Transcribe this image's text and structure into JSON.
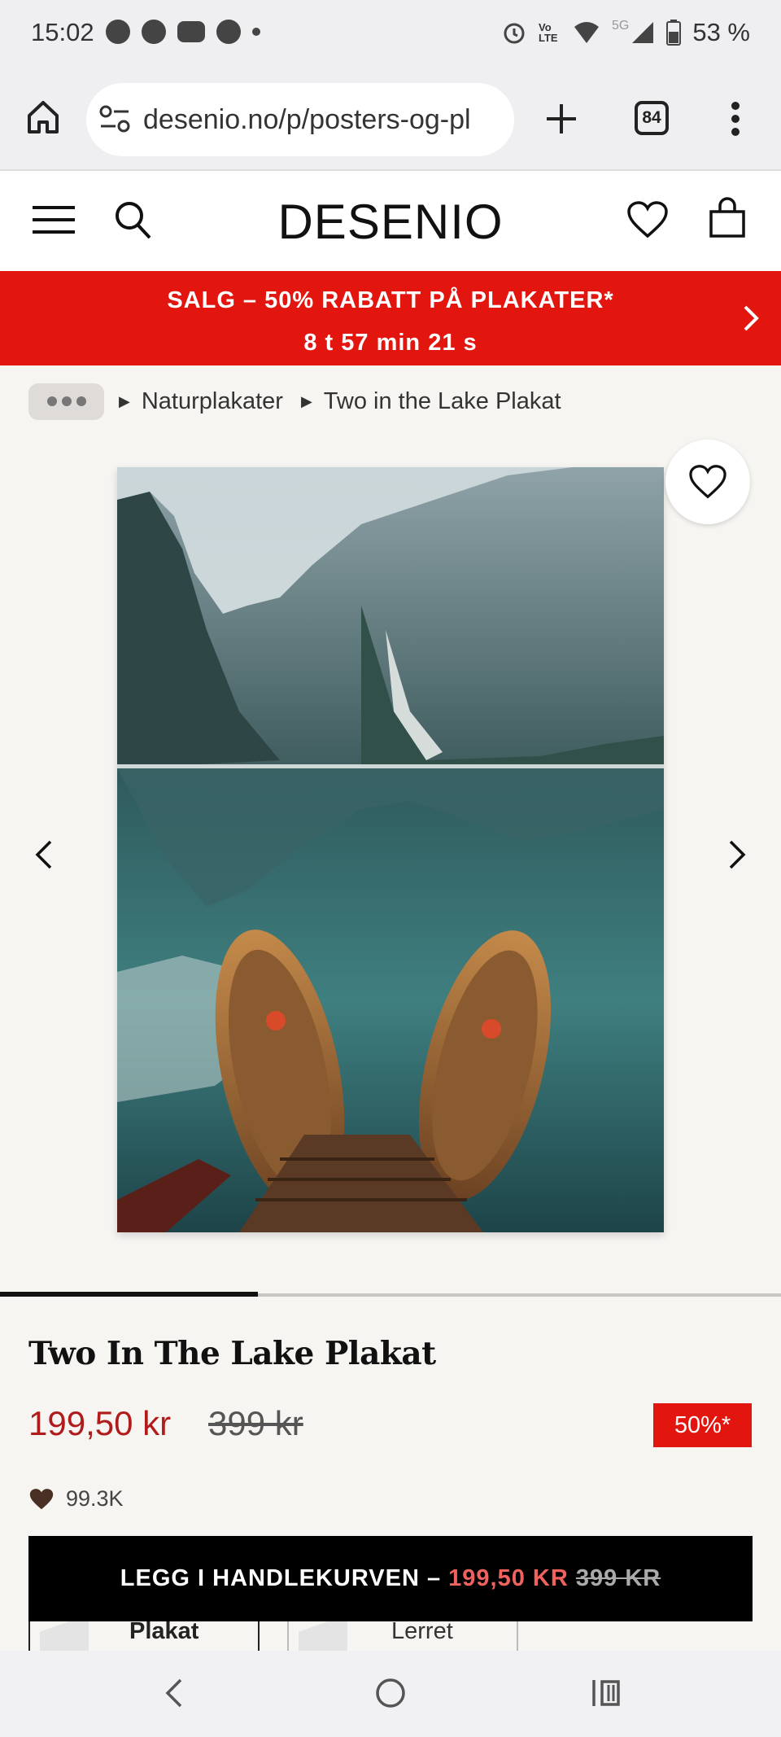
{
  "status_bar": {
    "time": "15:02",
    "battery": "53 %",
    "network": "5G",
    "volte": "Vo LTE"
  },
  "browser": {
    "url": "desenio.no/p/posters-og-pl",
    "tab_count": "84"
  },
  "site": {
    "logo": "DESENIO"
  },
  "sale_banner": {
    "headline": "SALG – 50% RABATT PÅ PLAKATER*",
    "countdown": "8 t 57 min 21 s"
  },
  "breadcrumb": {
    "items": [
      "Naturplakater",
      "Two in the Lake Plakat"
    ]
  },
  "product": {
    "title": "Two In The Lake Plakat",
    "price": "199,50 kr",
    "old_price": "399 kr",
    "discount": "50%*",
    "likes": "99.3K",
    "gallery_progress": 0.33
  },
  "cart_button": {
    "label": "LEGG I HANDLEKURVEN – ",
    "price": "199,50 KR",
    "old_price": "399 KR"
  },
  "formats": [
    {
      "label": "Plakat"
    },
    {
      "label": "Lerret"
    }
  ],
  "icons": {
    "home": "home-icon",
    "site-settings": "tune-icon",
    "new-tab": "plus-icon",
    "menu": "kebab-menu-icon",
    "hamburger": "hamburger-icon",
    "search": "search-icon",
    "wishlist": "heart-icon",
    "cart": "shopping-bag-icon"
  },
  "colors": {
    "sale_red": "#e2150f",
    "price_red": "#b01c1c",
    "cart_button": "#000000"
  }
}
